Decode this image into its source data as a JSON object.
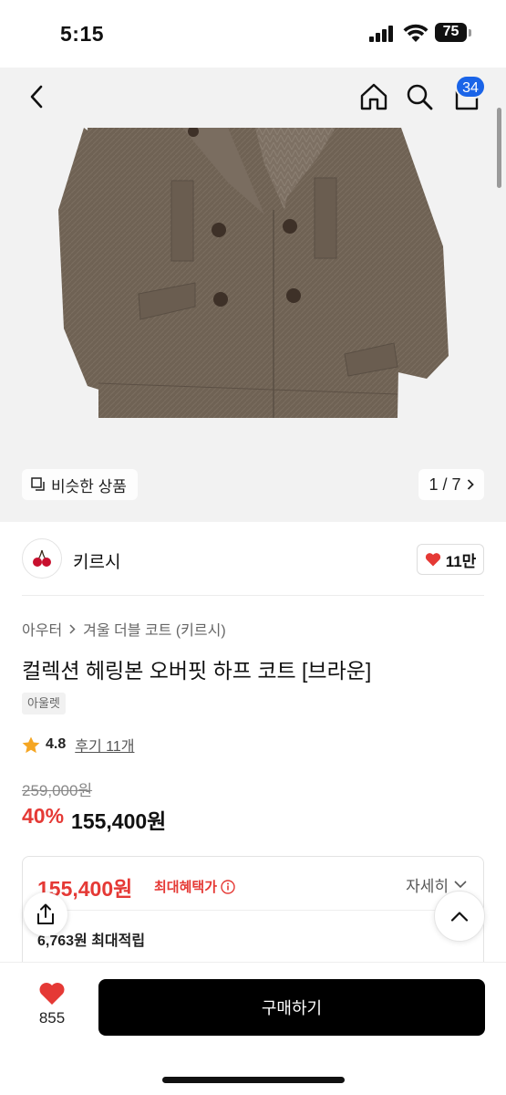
{
  "status_bar": {
    "time": "5:15",
    "battery": "75"
  },
  "header": {
    "back_icon": "chevron-left-icon",
    "home_icon": "home-icon",
    "search_icon": "search-icon",
    "cart_icon": "shopping-bag-icon",
    "cart_badge": "34"
  },
  "gallery": {
    "similar_label": "비슷한 상품",
    "pager": "1 / 7"
  },
  "shop": {
    "name": "키르시",
    "likes": "11만"
  },
  "product": {
    "breadcrumb": [
      "아우터",
      "겨울 더블 코트 (키르시)"
    ],
    "title": "컬렉션 헤링본 오버핏 하프 코트 [브라운]",
    "tag": "아울렛",
    "rating": "4.8",
    "reviews": "후기 11개",
    "original_price": "259,000원",
    "discount": "40%",
    "sale_price": "155,400원"
  },
  "benefit": {
    "best_price": "155,400원",
    "best_label": "최대혜택가",
    "detail_label": "자세히",
    "points": "6,763원 최대적립"
  },
  "bottom": {
    "wish_count": "855",
    "buy_label": "구매하기"
  },
  "colors": {
    "accent_red": "#e53935",
    "badge_blue": "#1a64e8",
    "buy_black": "#000000"
  }
}
